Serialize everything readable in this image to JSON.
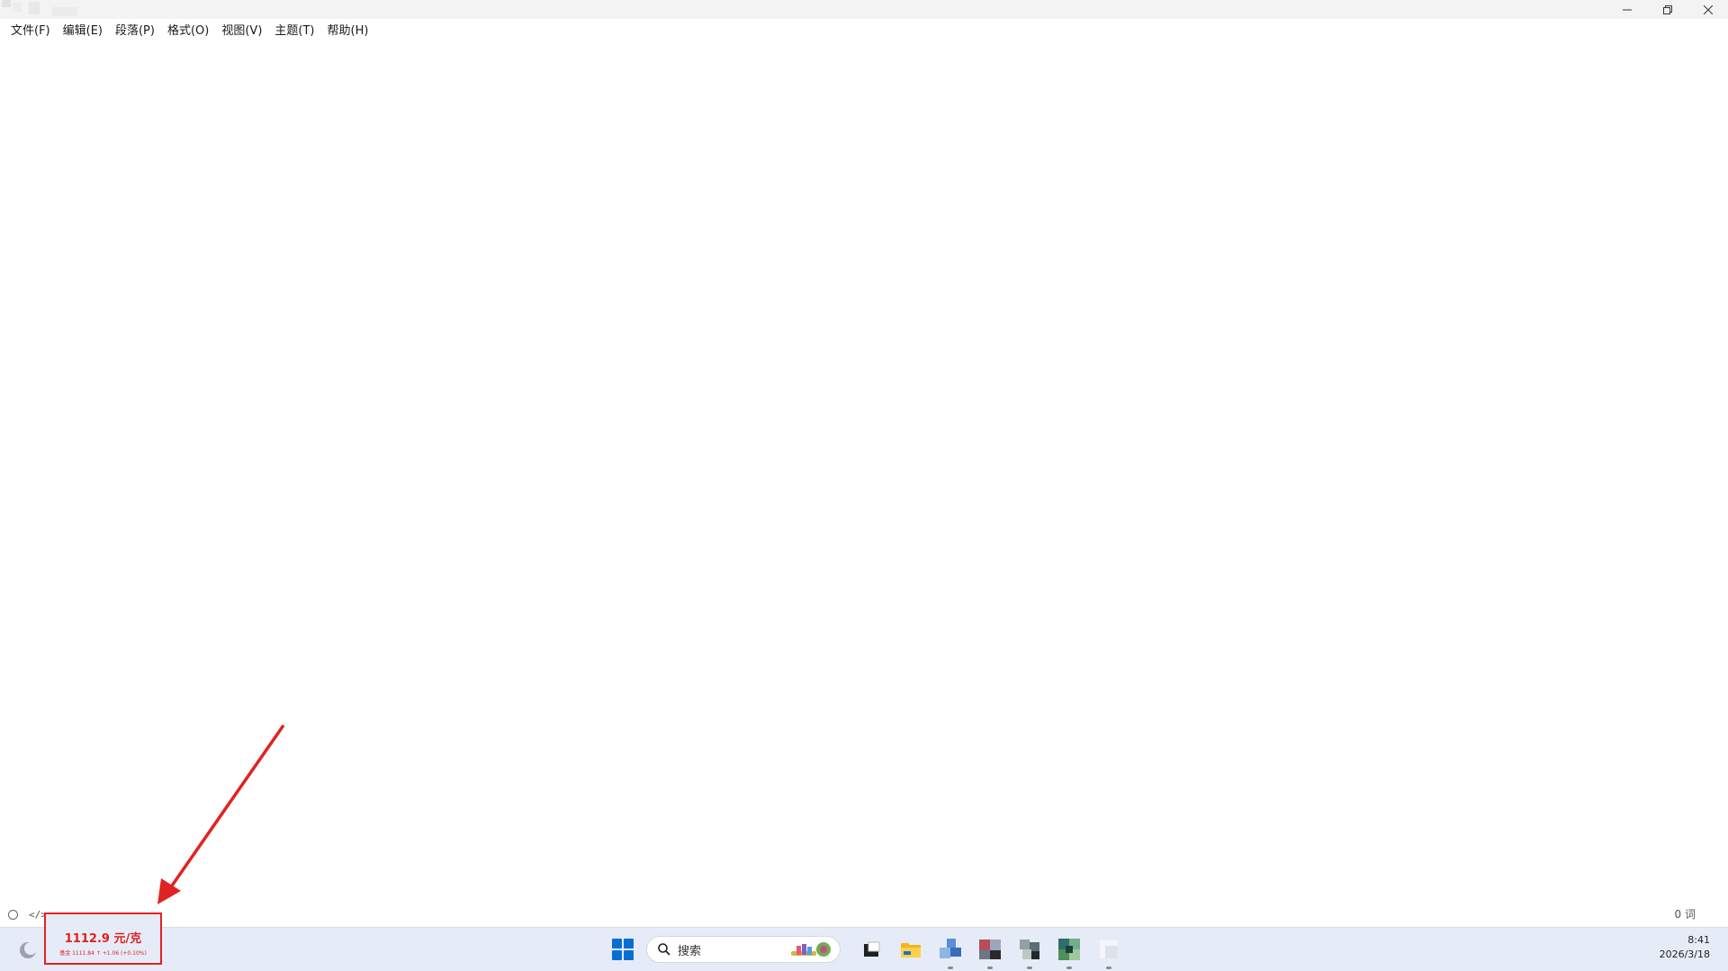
{
  "window": {
    "title": "",
    "controls": {
      "minimize_icon": "minimize-icon",
      "restore_icon": "restore-icon",
      "close_icon": "close-icon"
    }
  },
  "menu": [
    {
      "id": "file",
      "label": "文件(F)"
    },
    {
      "id": "edit",
      "label": "编辑(E)"
    },
    {
      "id": "paragraph",
      "label": "段落(P)"
    },
    {
      "id": "format",
      "label": "格式(O)"
    },
    {
      "id": "view",
      "label": "视图(V)"
    },
    {
      "id": "theme",
      "label": "主题(T)"
    },
    {
      "id": "help",
      "label": "帮助(H)"
    }
  ],
  "statusbar": {
    "left_icons": [
      "circle-icon",
      "code-icon"
    ],
    "code_glyph": "</>",
    "word_count": "0 词"
  },
  "taskbar": {
    "gold_widget": {
      "price": "1112.9 元/克",
      "detail": "基金 1111.84 ↑ +1.06 (+0.10%)",
      "highlight_color": "#e12222"
    },
    "search_placeholder": "搜索",
    "pinned_apps": [
      "start-icon",
      "search-icon",
      "folder-app-icon",
      "file-explorer-icon",
      "pinned-app-icon",
      "pinned-app-icon",
      "pinned-app-icon",
      "pinned-app-icon",
      "pinned-app-icon"
    ],
    "clock": {
      "time": "8:41",
      "date": "2026/3/18"
    }
  },
  "colors": {
    "accent": "#0a6ed1",
    "annotation": "#e12222",
    "taskbar_bg": "#e6ecf7"
  }
}
